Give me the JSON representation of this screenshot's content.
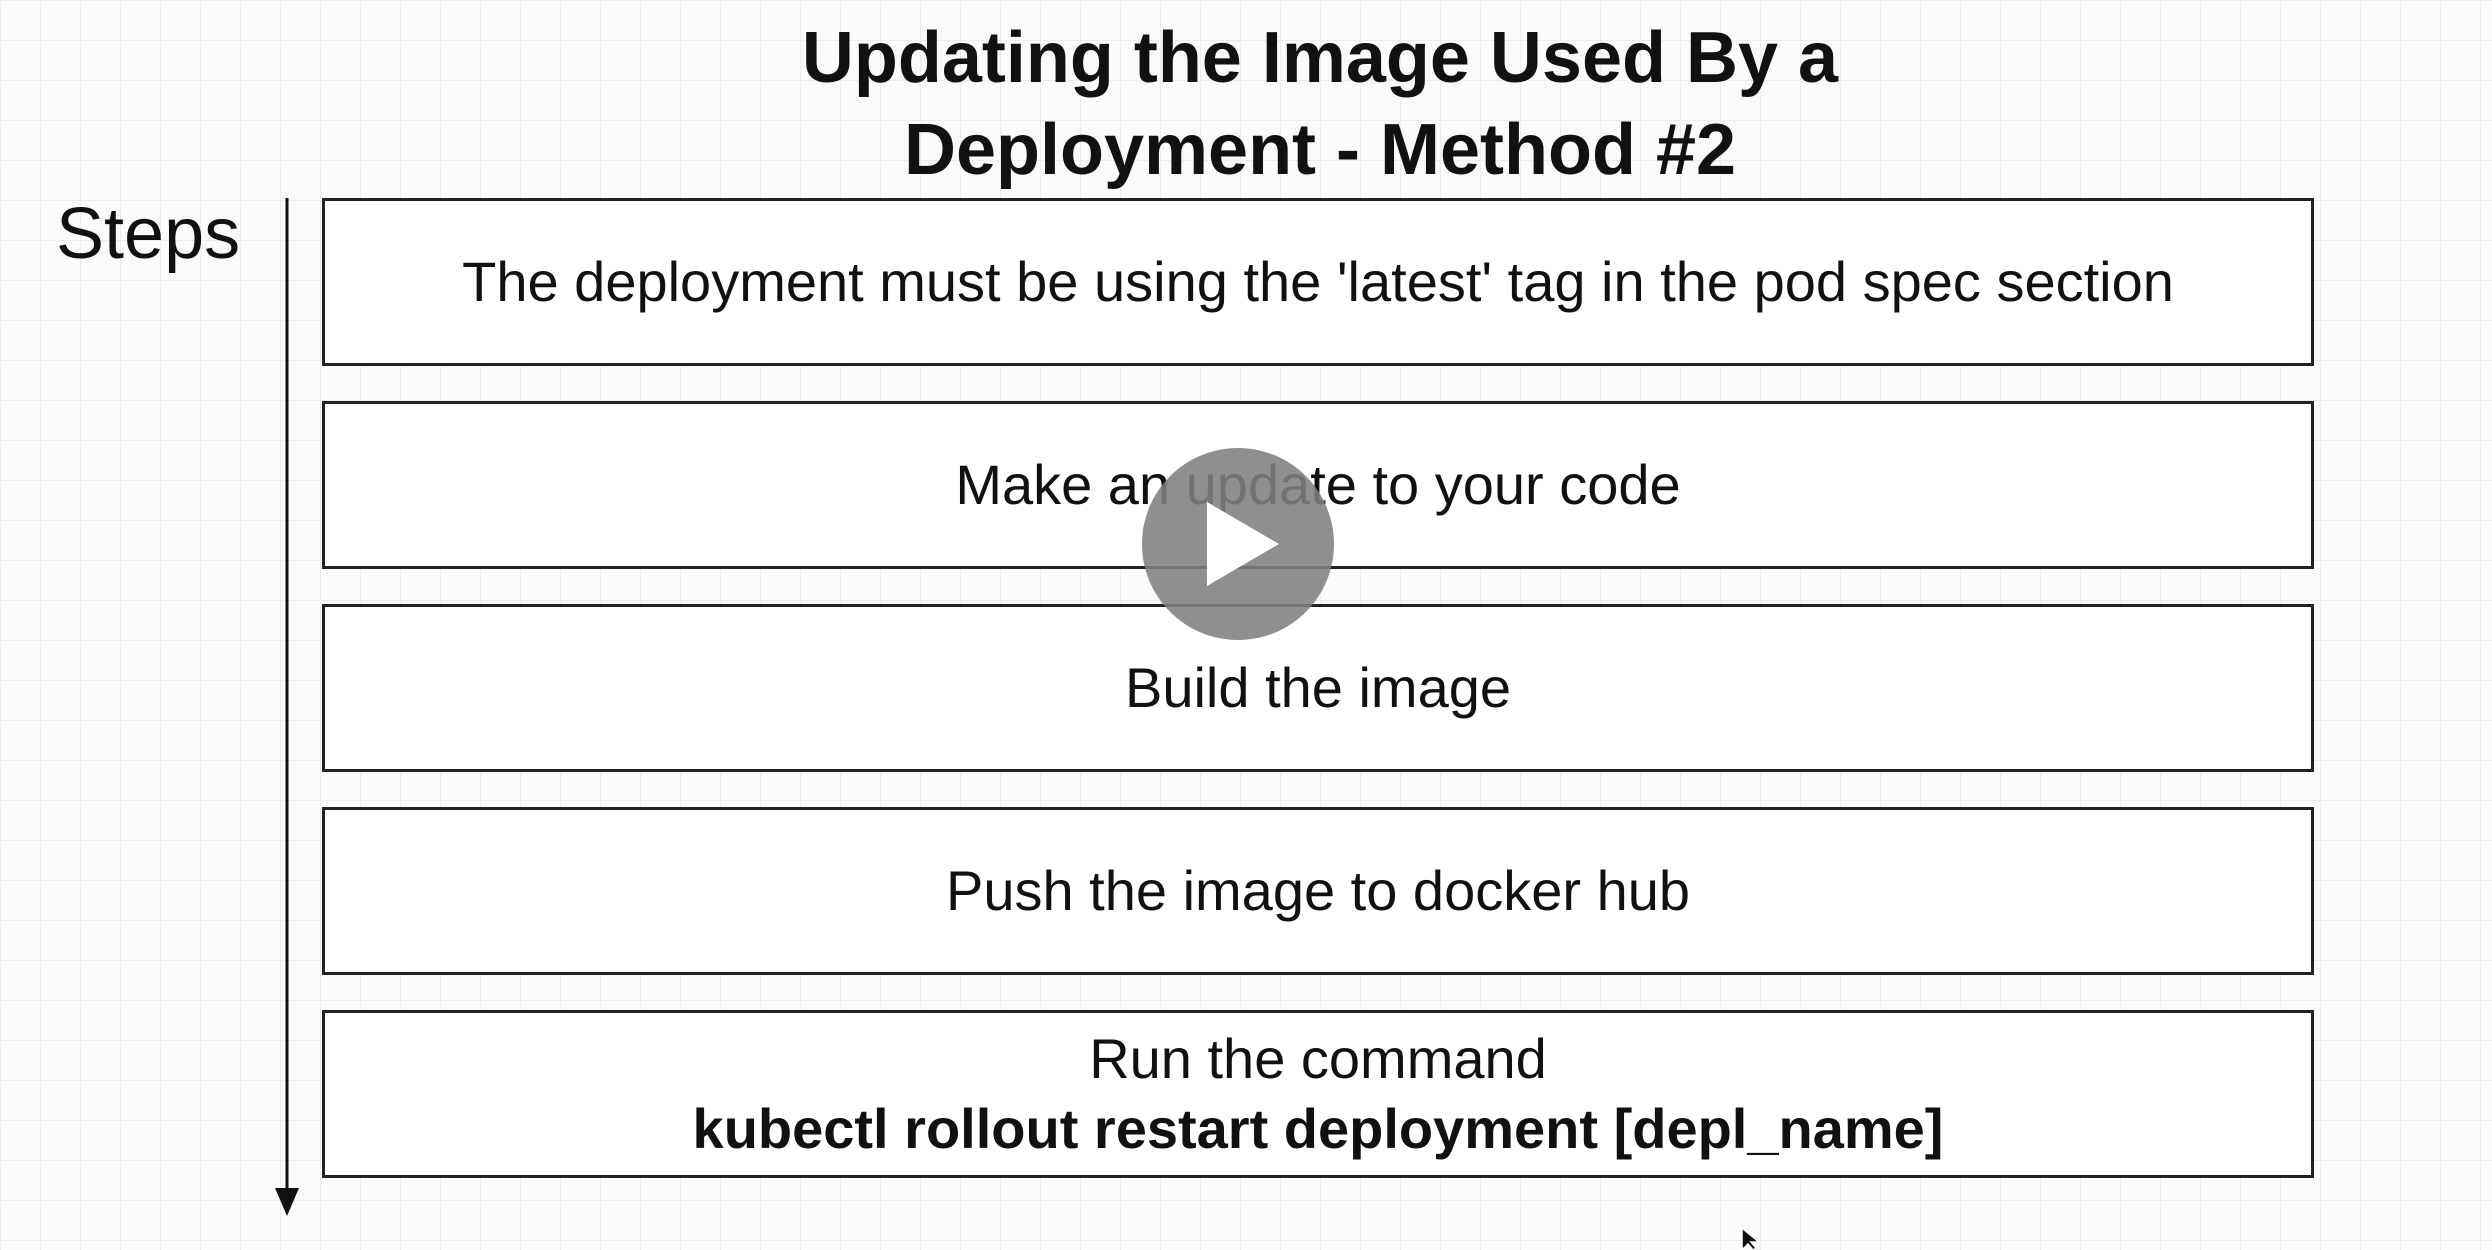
{
  "title": {
    "line1": "Updating the Image Used By a",
    "line2": "Deployment - Method #2"
  },
  "steps_label": "Steps",
  "steps": [
    {
      "text": "The deployment must be using the 'latest' tag in the pod spec section"
    },
    {
      "text": "Make an update to your code"
    },
    {
      "text": "Build the image"
    },
    {
      "text": "Push the image to docker hub"
    },
    {
      "text": "Run the command",
      "command": "kubectl rollout restart deployment [depl_name]"
    }
  ],
  "icons": {
    "play": "play-icon",
    "cursor": "mouse-cursor-icon",
    "arrow": "down-arrow-icon"
  },
  "colors": {
    "box_border": "#222222",
    "play_button": "#808080",
    "grid": "#ececec"
  }
}
